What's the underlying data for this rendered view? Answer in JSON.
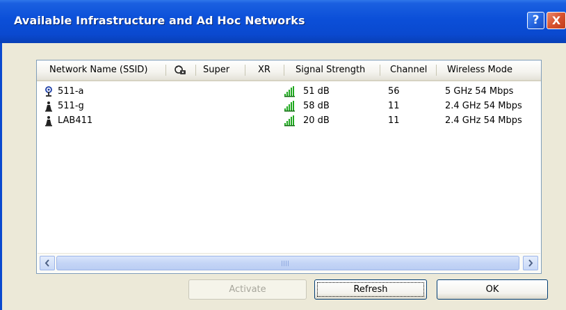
{
  "window": {
    "title": "Available Infrastructure and Ad Hoc Networks",
    "help_label": "?",
    "close_label": "X"
  },
  "columns": {
    "ssid": "Network Name (SSID)",
    "super": "Super",
    "xr": "XR",
    "signal": "Signal Strength",
    "channel": "Channel",
    "mode": "Wireless Mode"
  },
  "networks": [
    {
      "ssid": "511-a",
      "type_icon": "access-point-icon",
      "signal": "51 dB",
      "channel": "56",
      "mode": "5 GHz 54 Mbps"
    },
    {
      "ssid": "511-g",
      "type_icon": "adhoc-station-icon",
      "signal": "58 dB",
      "channel": "11",
      "mode": "2.4 GHz 54 Mbps"
    },
    {
      "ssid": "LAB411",
      "type_icon": "adhoc-station-icon",
      "signal": "20 dB",
      "channel": "11",
      "mode": "2.4 GHz 54 Mbps"
    }
  ],
  "buttons": {
    "activate": "Activate",
    "refresh": "Refresh",
    "ok": "OK"
  },
  "colors": {
    "title_bar": "#0a49cf",
    "signal_bars": "#1fa81f",
    "close_button": "#d8522e"
  }
}
